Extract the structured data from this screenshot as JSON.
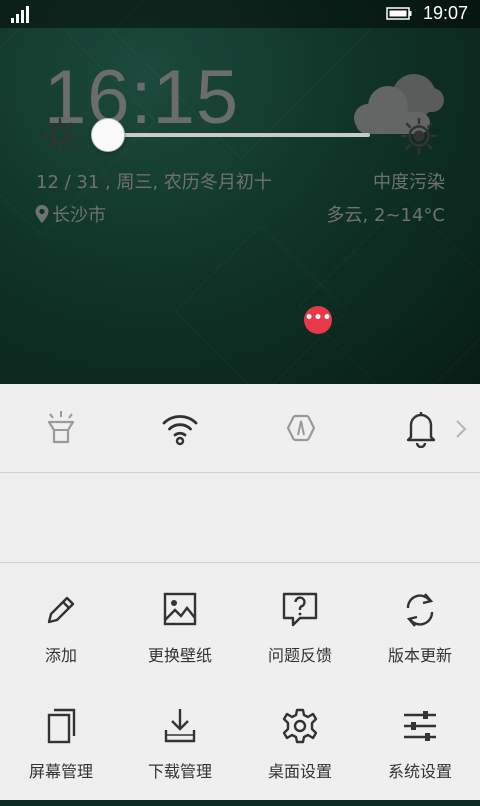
{
  "status_bar": {
    "time": "19:07"
  },
  "lockscreen": {
    "clock": "16:15",
    "date": "12 / 31 , 周三, 农历冬月初十",
    "location": "长沙市",
    "air_quality": "中度污染",
    "forecast": "多云, 2~14°C",
    "weather_icon": "cloudy-icon"
  },
  "quick_toggles": [
    {
      "name": "flashlight",
      "icon": "flashlight-icon",
      "active": false
    },
    {
      "name": "wifi",
      "icon": "wifi-icon",
      "active": true
    },
    {
      "name": "auto-rotate",
      "icon": "rotate-icon",
      "active": false
    },
    {
      "name": "sound",
      "icon": "bell-icon",
      "active": true
    }
  ],
  "brightness": {
    "level": 0.0
  },
  "shortcuts": [
    {
      "label": "添加",
      "icon": "pencil-icon"
    },
    {
      "label": "更换壁纸",
      "icon": "image-icon"
    },
    {
      "label": "问题反馈",
      "icon": "feedback-icon"
    },
    {
      "label": "版本更新",
      "icon": "refresh-icon"
    },
    {
      "label": "屏幕管理",
      "icon": "copy-icon"
    },
    {
      "label": "下载管理",
      "icon": "download-icon"
    },
    {
      "label": "桌面设置",
      "icon": "settings-gear-icon",
      "badge": "•••"
    },
    {
      "label": "系统设置",
      "icon": "sliders-icon"
    }
  ],
  "colors": {
    "panel": "#efefef",
    "badge": "#e8384a",
    "icon_active": "#333333",
    "icon_inactive": "#9a9a9a"
  }
}
